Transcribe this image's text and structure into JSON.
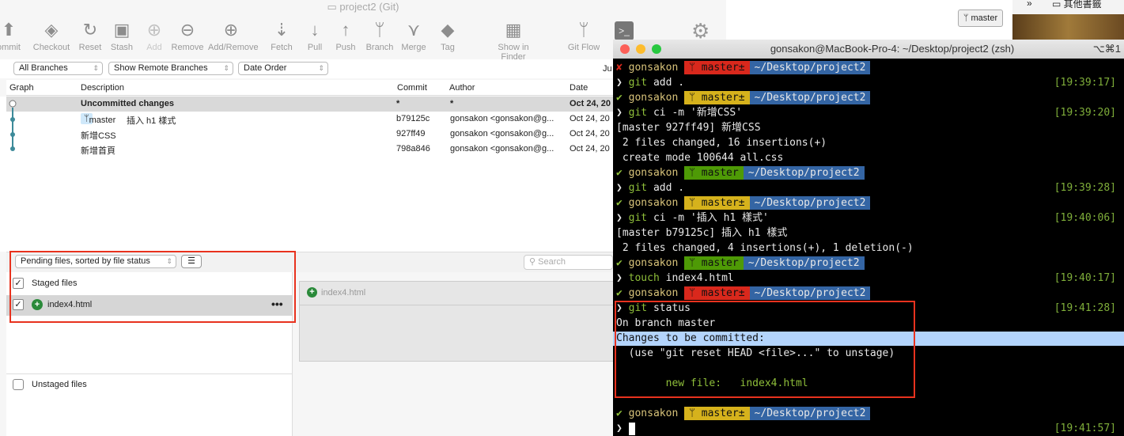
{
  "sourcetree": {
    "title": "project2 (Git)",
    "toolbar": [
      "ommit",
      "Checkout",
      "Reset",
      "Stash",
      "Add",
      "Remove",
      "Add/Remove",
      "Fetch",
      "Pull",
      "Push",
      "Branch",
      "Merge",
      "Tag",
      "Show in Finder",
      "Git Flow",
      "Te"
    ],
    "filters": [
      "All Branches",
      "Show Remote Branches",
      "Date Order"
    ],
    "filter_extra": "Ju",
    "columns": [
      "Graph",
      "Description",
      "Commit",
      "Author",
      "Date"
    ],
    "rows": [
      {
        "desc": "Uncommitted changes",
        "commit": "*",
        "author": "*",
        "date": "Oct 24, 20"
      },
      {
        "branch": "master",
        "desc": "插入 h1 樣式",
        "commit": "b79125c",
        "author": "gonsakon <gonsakon@g...",
        "date": "Oct 24, 20"
      },
      {
        "desc": "新增CSS",
        "commit": "927ff49",
        "author": "gonsakon <gonsakon@g...",
        "date": "Oct 24, 20"
      },
      {
        "desc": "新增首頁",
        "commit": "798a846",
        "author": "gonsakon <gonsakon@g...",
        "date": "Oct 24, 20"
      }
    ],
    "pending_select": "Pending files, sorted by file status",
    "search_placeholder": "Search",
    "staged_label": "Staged files",
    "staged_file": "index4.html",
    "diff_file": "index4.html",
    "unstaged_label": "Unstaged files"
  },
  "background": {
    "branch_button": "master",
    "bookmarks": "其他書籤",
    "chevron": "»"
  },
  "terminal": {
    "title": "gonsakon@MacBook-Pro-4: ~/Desktop/project2 (zsh)",
    "shortcut": "⌥⌘1",
    "user": "gonsakon",
    "path": "~/Desktop/project2",
    "lines": [
      {
        "type": "prompt",
        "status": "✘",
        "branch": "master±",
        "color": "#d9281c"
      },
      {
        "type": "cmd",
        "cmd": "git",
        "args": " add .",
        "ts": "[19:39:17]"
      },
      {
        "type": "prompt",
        "status": "✔",
        "branch": "master±",
        "color": "#d6b21c"
      },
      {
        "type": "cmd",
        "cmd": "git",
        "args": " ci -m '新增CSS'",
        "ts": "[19:39:20]"
      },
      {
        "type": "out",
        "text": "[master 927ff49] 新增CSS"
      },
      {
        "type": "out",
        "text": " 2 files changed, 16 insertions(+)"
      },
      {
        "type": "out",
        "text": " create mode 100644 all.css"
      },
      {
        "type": "prompt",
        "status": "✔",
        "branch": "master",
        "color": "#4e9a06"
      },
      {
        "type": "cmd",
        "cmd": "git",
        "args": " add .",
        "ts": "[19:39:28]"
      },
      {
        "type": "prompt",
        "status": "✔",
        "branch": "master±",
        "color": "#d6b21c"
      },
      {
        "type": "cmd",
        "cmd": "git",
        "args": " ci -m '插入 h1 樣式'",
        "ts": "[19:40:06]"
      },
      {
        "type": "out",
        "text": "[master b79125c] 插入 h1 樣式"
      },
      {
        "type": "out",
        "text": " 2 files changed, 4 insertions(+), 1 deletion(-)"
      },
      {
        "type": "prompt",
        "status": "✔",
        "branch": "master",
        "color": "#4e9a06"
      },
      {
        "type": "cmd",
        "cmd": "touch",
        "args": " index4.html",
        "ts": "[19:40:17]"
      },
      {
        "type": "prompt",
        "status": "✔",
        "branch": "master±",
        "color": "#d9281c"
      },
      {
        "type": "cmd",
        "cmd": "git",
        "args": " status",
        "ts": "[19:41:28]"
      },
      {
        "type": "out",
        "text": "On branch master"
      },
      {
        "type": "sel",
        "text": "Changes to be committed:"
      },
      {
        "type": "out",
        "text": "  (use \"git reset HEAD <file>...\" to unstage)"
      },
      {
        "type": "out",
        "text": ""
      },
      {
        "type": "new",
        "text": "        new file:   index4.html"
      },
      {
        "type": "out",
        "text": ""
      },
      {
        "type": "prompt",
        "status": "✔",
        "branch": "master±",
        "color": "#d6b21c"
      },
      {
        "type": "cmd",
        "cmd": "",
        "args": "",
        "ts": "[19:41:57]",
        "cursor": true
      }
    ]
  },
  "colors": {
    "highlight_box": "#e8321e",
    "path_segment": "#3465a4",
    "selection": "#b3d4fc"
  }
}
